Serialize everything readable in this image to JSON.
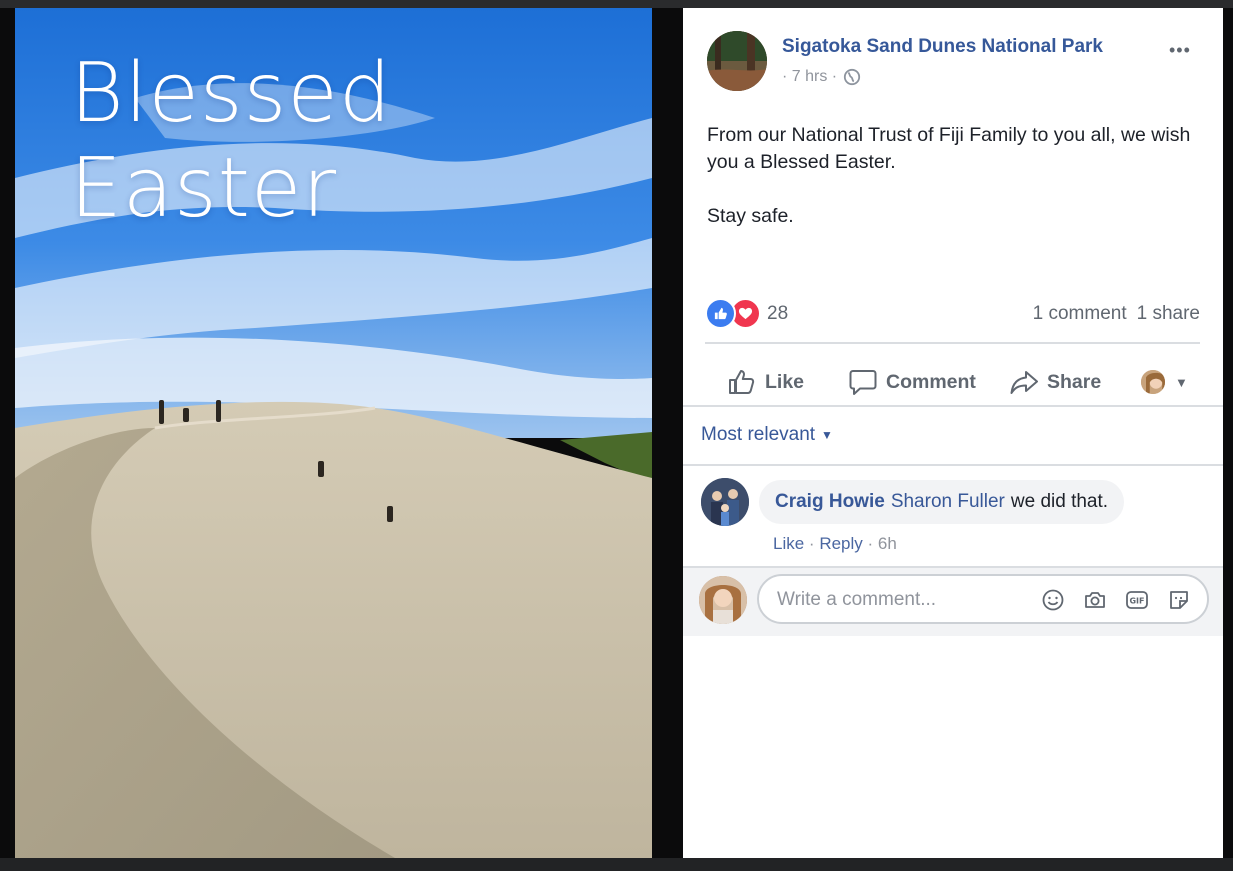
{
  "photo": {
    "overlay_text": "Blessed Easter"
  },
  "post": {
    "page_name": "Sigatoka Sand Dunes National Park",
    "time": "· 7 hrs ·",
    "body_line1": "From our National Trust of Fiji Family to you all, we wish you a Blessed Easter.",
    "body_line2": "Stay safe.",
    "reaction_count": "28",
    "comments_count": "1 comment",
    "shares_count": "1 share"
  },
  "actions": {
    "like": "Like",
    "comment": "Comment",
    "share": "Share"
  },
  "comments": {
    "sort_label": "Most relevant",
    "items": [
      {
        "author": "Craig Howie",
        "tag": "Sharon Fuller",
        "text": "we did that.",
        "like": "Like",
        "reply": "Reply",
        "time": "6h"
      }
    ]
  },
  "composer": {
    "placeholder": "Write a comment..."
  },
  "colors": {
    "link": "#365899",
    "like_blue": "#3b7cf0",
    "love_red": "#f0364f"
  }
}
